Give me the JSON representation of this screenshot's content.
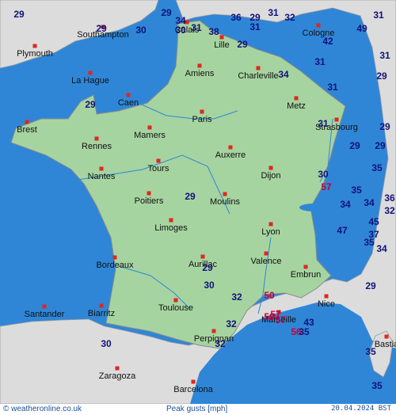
{
  "map": {
    "colors": {
      "sea": "#2f86d7",
      "france": "#a6d4a0",
      "other_land": "#dcdcdc",
      "city_marker": "#e0261e",
      "value_normal": "#12127a",
      "value_high": "#c4003a"
    },
    "cities": [
      {
        "name": "Calais"
      },
      {
        "name": "Southampton"
      },
      {
        "name": "Plymouth"
      },
      {
        "name": "Lille"
      },
      {
        "name": "Cologne"
      },
      {
        "name": "La Hague"
      },
      {
        "name": "Amiens"
      },
      {
        "name": "Charleville"
      },
      {
        "name": "Caen"
      },
      {
        "name": "Metz"
      },
      {
        "name": "Brest"
      },
      {
        "name": "Paris"
      },
      {
        "name": "Strasbourg"
      },
      {
        "name": "Mamers"
      },
      {
        "name": "Rennes"
      },
      {
        "name": "Auxerre"
      },
      {
        "name": "Tours"
      },
      {
        "name": "Nantes"
      },
      {
        "name": "Dijon"
      },
      {
        "name": "Poitiers"
      },
      {
        "name": "Moulins"
      },
      {
        "name": "Limoges"
      },
      {
        "name": "Lyon"
      },
      {
        "name": "Bordeaux"
      },
      {
        "name": "Aurillac"
      },
      {
        "name": "Valence"
      },
      {
        "name": "Embrun"
      },
      {
        "name": "Toulouse"
      },
      {
        "name": "Nice"
      },
      {
        "name": "Santander"
      },
      {
        "name": "Biarritz"
      },
      {
        "name": "Marseille"
      },
      {
        "name": "Perpignan"
      },
      {
        "name": "Bastia"
      },
      {
        "name": "Zaragoza"
      },
      {
        "name": "Barcelona"
      }
    ],
    "gust_values": [
      {
        "v": "29"
      },
      {
        "v": "34"
      },
      {
        "v": "30"
      },
      {
        "v": "36"
      },
      {
        "v": "31"
      },
      {
        "v": "38"
      },
      {
        "v": "29"
      },
      {
        "v": "31"
      },
      {
        "v": "31"
      },
      {
        "v": "32"
      },
      {
        "v": "29"
      },
      {
        "v": "30"
      },
      {
        "v": "31"
      },
      {
        "v": "49"
      },
      {
        "v": "42"
      },
      {
        "v": "29"
      },
      {
        "v": "29"
      },
      {
        "v": "31"
      },
      {
        "v": "31"
      },
      {
        "v": "34"
      },
      {
        "v": "29"
      },
      {
        "v": "31"
      },
      {
        "v": "29"
      },
      {
        "v": "29"
      },
      {
        "v": "31"
      },
      {
        "v": "29"
      },
      {
        "v": "29"
      },
      {
        "v": "30"
      },
      {
        "v": "35"
      },
      {
        "v": "57"
      },
      {
        "v": "35"
      },
      {
        "v": "34"
      },
      {
        "v": "34"
      },
      {
        "v": "36"
      },
      {
        "v": "32"
      },
      {
        "v": "45"
      },
      {
        "v": "47"
      },
      {
        "v": "37"
      },
      {
        "v": "35"
      },
      {
        "v": "34"
      },
      {
        "v": "29"
      },
      {
        "v": "29"
      },
      {
        "v": "30"
      },
      {
        "v": "32"
      },
      {
        "v": "50"
      },
      {
        "v": "29"
      },
      {
        "v": "57"
      },
      {
        "v": "50"
      },
      {
        "v": "57"
      },
      {
        "v": "32"
      },
      {
        "v": "43"
      },
      {
        "v": "56"
      },
      {
        "v": "35"
      },
      {
        "v": "30"
      },
      {
        "v": "32"
      },
      {
        "v": "35"
      },
      {
        "v": "35"
      }
    ]
  },
  "footer": {
    "credit": "© weatheronline.co.uk",
    "product": "Peak gusts [mph]",
    "date": "20.04.2024 BST"
  }
}
